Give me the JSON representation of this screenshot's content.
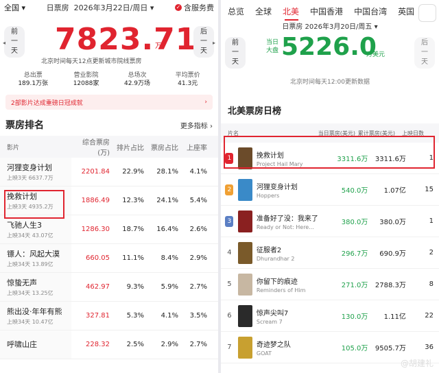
{
  "left": {
    "region": "全国",
    "date_label": "日票房",
    "date": "2026年3月22日/周日",
    "service": "含服务费",
    "prev_btn": [
      "前",
      "一",
      "天"
    ],
    "next_btn": [
      "后",
      "一",
      "天"
    ],
    "big_value": "7823.71",
    "big_unit": "万",
    "note": "北京时间每天12点更新城市院线票房",
    "stats": [
      {
        "label": "总出票",
        "value": "189.1万张"
      },
      {
        "label": "营业影院",
        "value": "12088家"
      },
      {
        "label": "总场次",
        "value": "42.9万场"
      },
      {
        "label": "平均票价",
        "value": "41.3元"
      }
    ],
    "banner": "2部影片达成重磅日冠成就",
    "section_title": "票房排名",
    "more": "更多指标",
    "headers": {
      "film": "影片",
      "gross": "综合票房(万)",
      "sched": "排片占比",
      "share": "票房占比",
      "occ": "上座率"
    },
    "rows": [
      {
        "name": "河狸变身计划",
        "sub": "上映3天 6637.7万",
        "gross": "2201.84",
        "sched": "22.9%",
        "share": "28.1%",
        "occ": "4.1%"
      },
      {
        "name": "挽救计划",
        "sub": "上映3天 4935.2万",
        "gross": "1886.49",
        "sched": "12.3%",
        "share": "24.1%",
        "occ": "5.4%"
      },
      {
        "name": "飞驰人生3",
        "sub": "上映34天 43.07亿",
        "gross": "1286.30",
        "sched": "18.7%",
        "share": "16.4%",
        "occ": "2.6%"
      },
      {
        "name": "镖人：风起大漠",
        "sub": "上映34天 13.89亿",
        "gross": "660.05",
        "sched": "11.1%",
        "share": "8.4%",
        "occ": "2.9%"
      },
      {
        "name": "惊蛰无声",
        "sub": "上映34天 13.25亿",
        "gross": "462.97",
        "sched": "9.3%",
        "share": "5.9%",
        "occ": "2.7%"
      },
      {
        "name": "熊出没·年年有熊",
        "sub": "上映34天 10.47亿",
        "gross": "327.81",
        "sched": "5.3%",
        "share": "4.1%",
        "occ": "3.5%"
      },
      {
        "name": "呼啸山庄",
        "sub": "",
        "gross": "228.32",
        "sched": "2.5%",
        "share": "2.9%",
        "occ": "2.7%"
      }
    ]
  },
  "right": {
    "tabs": [
      "总览",
      "全球",
      "北美",
      "中国香港",
      "中国台湾",
      "英国"
    ],
    "active_tab": "北美",
    "date": "日票房 2026年3月20日/周五",
    "big_label": [
      "当日",
      "大盘"
    ],
    "big_value": "5226.0",
    "big_unit": "万美元",
    "note": "北京时间每天12:00更新数据",
    "prev_btn": [
      "前",
      "一",
      "天"
    ],
    "next_btn": [
      "后",
      "一",
      "天"
    ],
    "section_title": "北美票房日榜",
    "headers": {
      "film": "片名",
      "day": "当日票房(美元)",
      "total": "累计票房(美元)",
      "days": "上映日数"
    },
    "rows": [
      {
        "rank": "1",
        "name": "挽救计划",
        "en": "Project Hail Mary",
        "day": "3311.6万",
        "total": "3311.6万",
        "days": "1",
        "poster": "#6b4b2a",
        "badge": "#e0242f"
      },
      {
        "rank": "2",
        "name": "河狸变身计划",
        "en": "Hoppers",
        "day": "540.0万",
        "total": "1.07亿",
        "days": "15",
        "poster": "#3a8ac8",
        "badge": "#f0a033"
      },
      {
        "rank": "3",
        "name": "准备好了没：我来了",
        "en": "Ready or Not: Here...",
        "day": "380.0万",
        "total": "380.0万",
        "days": "1",
        "poster": "#8a2020",
        "badge": "#5b7fc4"
      },
      {
        "rank": "4",
        "name": "征服者2",
        "en": "Dhurandhar 2",
        "day": "296.7万",
        "total": "690.9万",
        "days": "2",
        "poster": "#7a5a2a",
        "badge": ""
      },
      {
        "rank": "5",
        "name": "你留下的痕迹",
        "en": "Reminders of Him",
        "day": "271.0万",
        "total": "2788.3万",
        "days": "8",
        "poster": "#c7b7a2",
        "badge": ""
      },
      {
        "rank": "6",
        "name": "惊声尖叫7",
        "en": "Scream 7",
        "day": "130.0万",
        "total": "1.11亿",
        "days": "22",
        "poster": "#2a2a2a",
        "badge": ""
      },
      {
        "rank": "7",
        "name": "奇迹梦之队",
        "en": "GOAT",
        "day": "105.0万",
        "total": "9505.7万",
        "days": "36",
        "poster": "#c8a030",
        "badge": ""
      }
    ],
    "watermark": "@胡建礼"
  },
  "colors": {
    "accent_red": "#e0242f",
    "accent_green": "#1fa14b"
  }
}
